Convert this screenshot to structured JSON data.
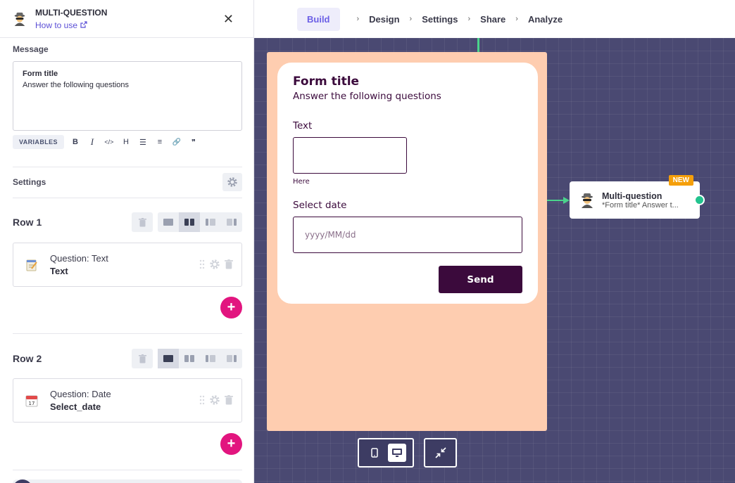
{
  "topbar": {
    "tabs": [
      "Build",
      "Design",
      "Settings",
      "Share",
      "Analyze"
    ],
    "active_tab": "Build",
    "separator": "›"
  },
  "panel": {
    "title": "MULTI-QUESTION",
    "howto_link": "How to use",
    "close_icon": "close-icon",
    "message_label": "Message",
    "message_title": "Form title",
    "message_body": "Answer the following questions",
    "variables_button": "VARIABLES",
    "toolbar_icons": [
      "bold-icon",
      "italic-icon",
      "code-icon",
      "heading-icon",
      "bullet-list-icon",
      "numbered-list-icon",
      "link-icon",
      "quote-icon"
    ],
    "toolbar_glyphs": [
      "B",
      "I",
      "</>",
      "H",
      "☰",
      "≡",
      "🔗",
      "❞"
    ],
    "settings_label": "Settings",
    "rows": [
      {
        "title": "Row 1",
        "selected_layout": 1,
        "question_type": "Question: Text",
        "question_name": "Text",
        "icon": "notepad-icon"
      },
      {
        "title": "Row 2",
        "selected_layout": 0,
        "question_type": "Question: Date",
        "question_name": "Select_date",
        "icon": "calendar-icon"
      }
    ],
    "add_label": "+"
  },
  "preview": {
    "title": "Form title",
    "subtitle": "Answer the following questions",
    "field1_label": "Text",
    "field1_hint": "Here",
    "field2_label": "Select date",
    "field2_placeholder": "yyyy/MM/dd",
    "send_label": "Send",
    "bg_color": "#fecdb0",
    "accent_color": "#3b0a3c"
  },
  "node": {
    "badge": "NEW",
    "title": "Multi-question",
    "subtitle": "*Form title* Answer t..."
  },
  "device_toggle": {
    "options": [
      "mobile-icon",
      "desktop-icon"
    ],
    "selected": "desktop-icon"
  }
}
